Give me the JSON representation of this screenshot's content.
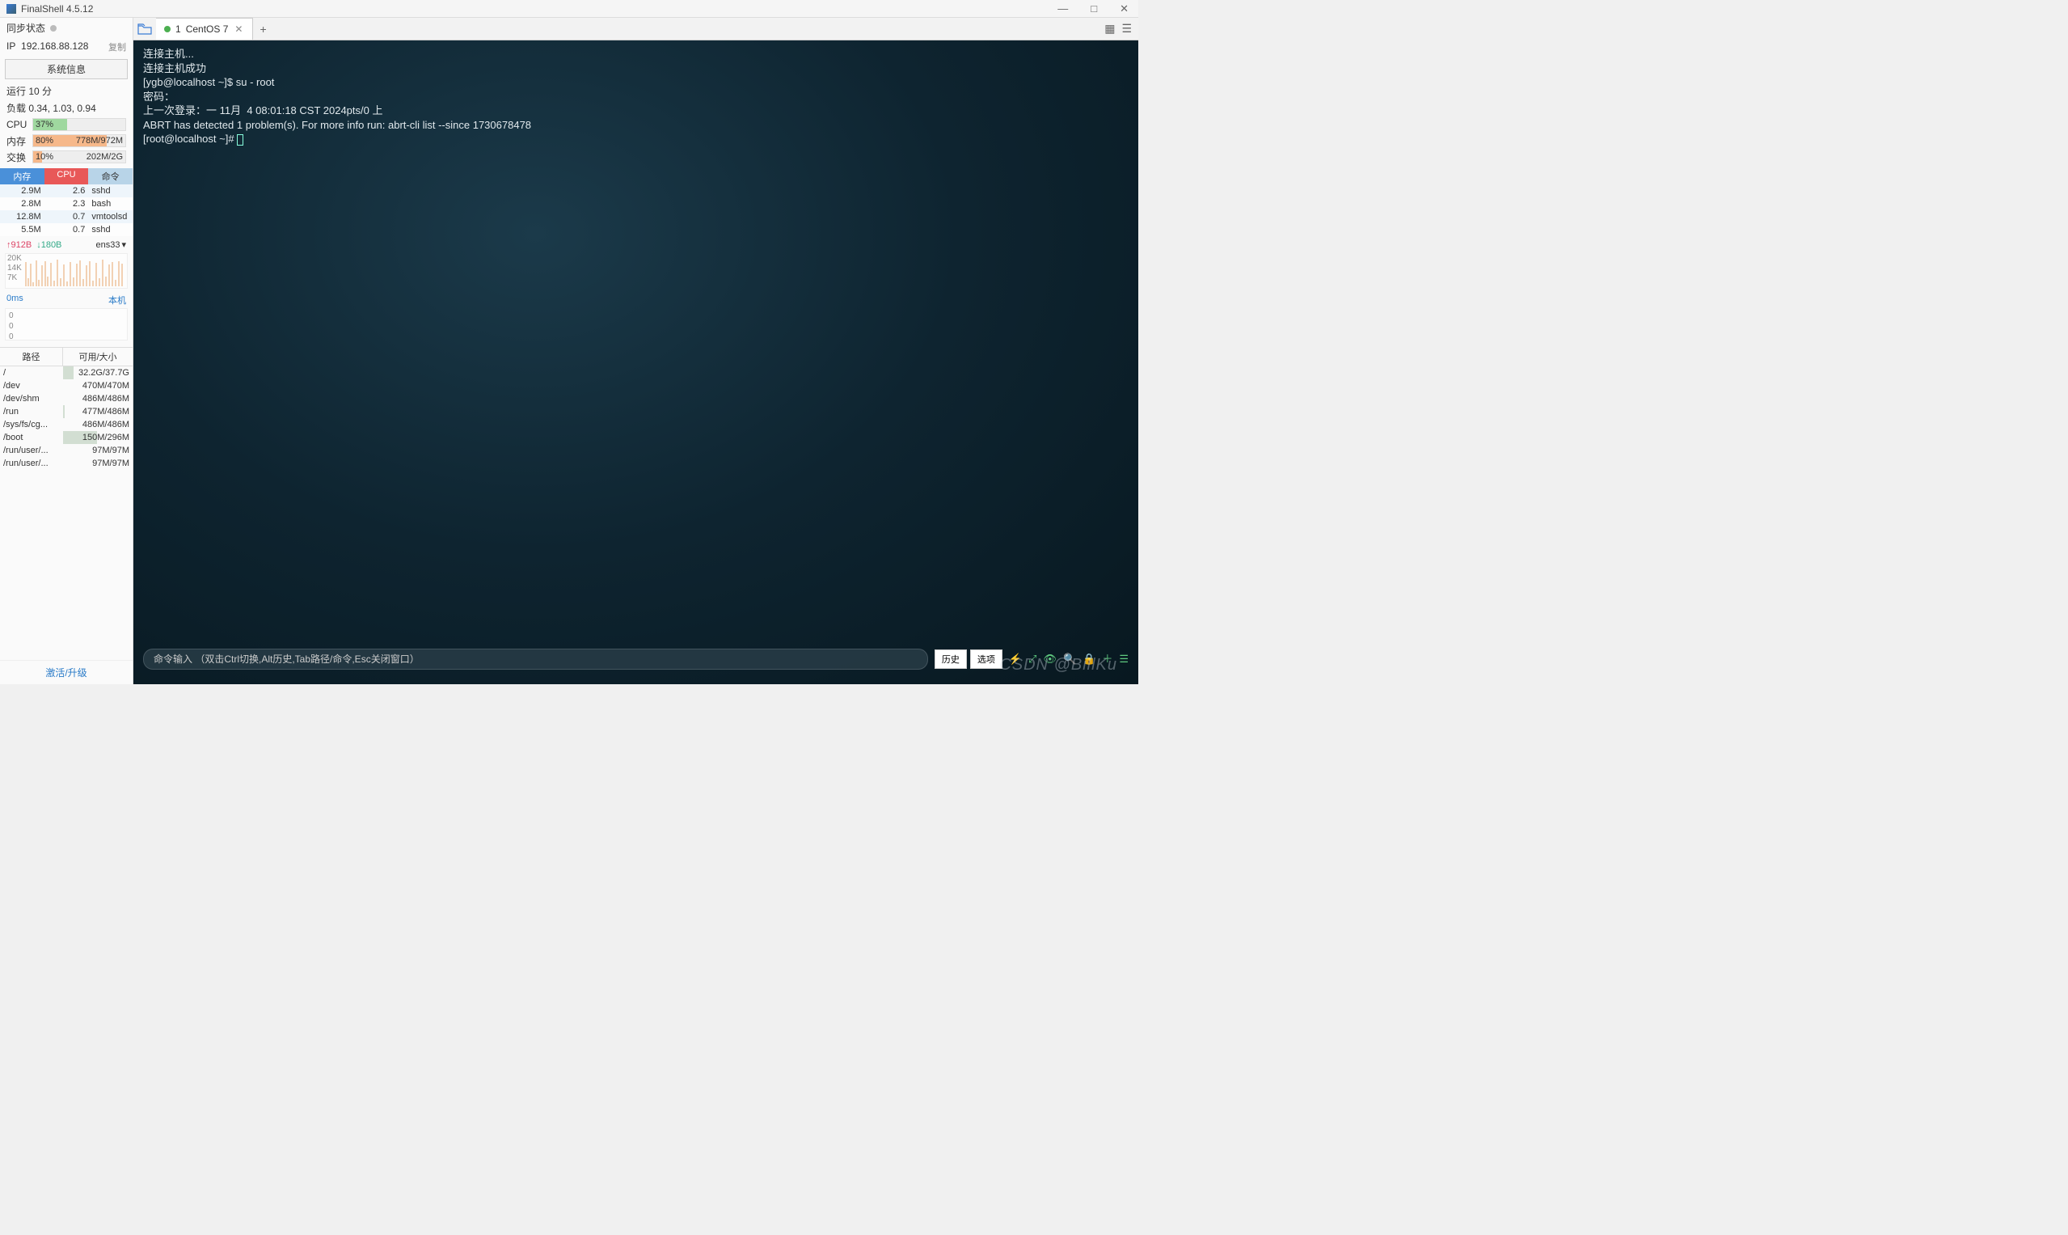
{
  "app": {
    "title": "FinalShell 4.5.12"
  },
  "win_controls": {
    "min": "—",
    "max": "□",
    "close": "✕"
  },
  "sidebar": {
    "sync_label": "同步状态",
    "ip_label": "IP",
    "ip_value": "192.168.88.128",
    "copy_label": "复制",
    "sysinfo_btn": "系统信息",
    "uptime": "运行 10 分",
    "load_label": "负载 0.34, 1.03, 0.94",
    "cpu": {
      "label": "CPU",
      "pct": "37%",
      "width": "37%"
    },
    "mem": {
      "label": "内存",
      "pct": "80%",
      "detail": "778M/972M",
      "width": "80%"
    },
    "swap": {
      "label": "交换",
      "pct": "10%",
      "detail": "202M/2G",
      "width": "10%"
    },
    "proc_headers": {
      "mem": "内存",
      "cpu": "CPU",
      "cmd": "命令"
    },
    "procs": [
      {
        "mem": "2.9M",
        "cpu": "2.6",
        "cmd": "sshd"
      },
      {
        "mem": "2.8M",
        "cpu": "2.3",
        "cmd": "bash"
      },
      {
        "mem": "12.8M",
        "cpu": "0.7",
        "cmd": "vmtoolsd"
      },
      {
        "mem": "5.5M",
        "cpu": "0.7",
        "cmd": "sshd"
      }
    ],
    "net": {
      "up": "↑912B",
      "down": "↓180B",
      "iface": "ens33",
      "y_labels": [
        "20K",
        "14K",
        "7K"
      ]
    },
    "ping": {
      "ms": "0ms",
      "host_label": "本机",
      "y_labels": [
        "0",
        "0",
        "0"
      ]
    },
    "disk_headers": {
      "path": "路径",
      "usage": "可用/大小"
    },
    "disks": [
      {
        "path": "/",
        "usage": "32.2G/37.7G",
        "pct": 15
      },
      {
        "path": "/dev",
        "usage": "470M/470M",
        "pct": 0
      },
      {
        "path": "/dev/shm",
        "usage": "486M/486M",
        "pct": 0
      },
      {
        "path": "/run",
        "usage": "477M/486M",
        "pct": 2
      },
      {
        "path": "/sys/fs/cg...",
        "usage": "486M/486M",
        "pct": 0
      },
      {
        "path": "/boot",
        "usage": "150M/296M",
        "pct": 49
      },
      {
        "path": "/run/user/...",
        "usage": "97M/97M",
        "pct": 0
      },
      {
        "path": "/run/user/...",
        "usage": "97M/97M",
        "pct": 0
      }
    ],
    "activate": "激活/升级"
  },
  "tabs": {
    "current": {
      "index": "1",
      "label": "CentOS 7"
    }
  },
  "terminal": {
    "lines": [
      "连接主机...",
      "连接主机成功",
      "[ygb@localhost ~]$ su - root",
      "密码：",
      "上一次登录：一 11月  4 08:01:18 CST 2024pts/0 上",
      "ABRT has detected 1 problem(s). For more info run: abrt-cli list --since 1730678478",
      "[root@localhost ~]# "
    ],
    "cmd_placeholder": "命令输入 （双击Ctrl切换,Alt历史,Tab路径/命令,Esc关闭窗口）",
    "btn_history": "历史",
    "btn_options": "选项"
  },
  "watermark": "CSDN @BillKu"
}
